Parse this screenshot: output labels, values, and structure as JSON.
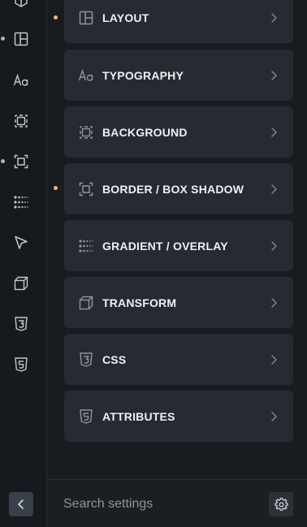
{
  "sidebar": {
    "icons": [
      {
        "name": "box-partial-icon"
      },
      {
        "name": "layout-icon",
        "modified": true
      },
      {
        "name": "typography-icon"
      },
      {
        "name": "background-icon"
      },
      {
        "name": "border-icon",
        "modified": true
      },
      {
        "name": "gradient-icon"
      },
      {
        "name": "pointer-icon"
      },
      {
        "name": "transform-cube-icon"
      },
      {
        "name": "css3-icon"
      },
      {
        "name": "html5-icon"
      }
    ],
    "collapse_icon": "chevron-left-icon"
  },
  "sections": [
    {
      "label": "LAYOUT",
      "icon": "layout-icon",
      "modified": true
    },
    {
      "label": "TYPOGRAPHY",
      "icon": "typography-icon",
      "modified": false
    },
    {
      "label": "BACKGROUND",
      "icon": "background-icon",
      "modified": false
    },
    {
      "label": "BORDER / BOX SHADOW",
      "icon": "border-icon",
      "modified": true
    },
    {
      "label": "GRADIENT / OVERLAY",
      "icon": "gradient-icon",
      "modified": false
    },
    {
      "label": "TRANSFORM",
      "icon": "transform-cube-icon",
      "modified": false
    },
    {
      "label": "CSS",
      "icon": "css3-icon",
      "modified": false
    },
    {
      "label": "ATTRIBUTES",
      "icon": "html5-icon",
      "modified": false
    }
  ],
  "footer": {
    "search": {
      "placeholder": "Search settings",
      "value": ""
    },
    "settings_icon": "gear-icon"
  },
  "colors": {
    "modified_dot": "#f0c060",
    "card_bg": "#262b32",
    "page_bg": "#181b20"
  }
}
